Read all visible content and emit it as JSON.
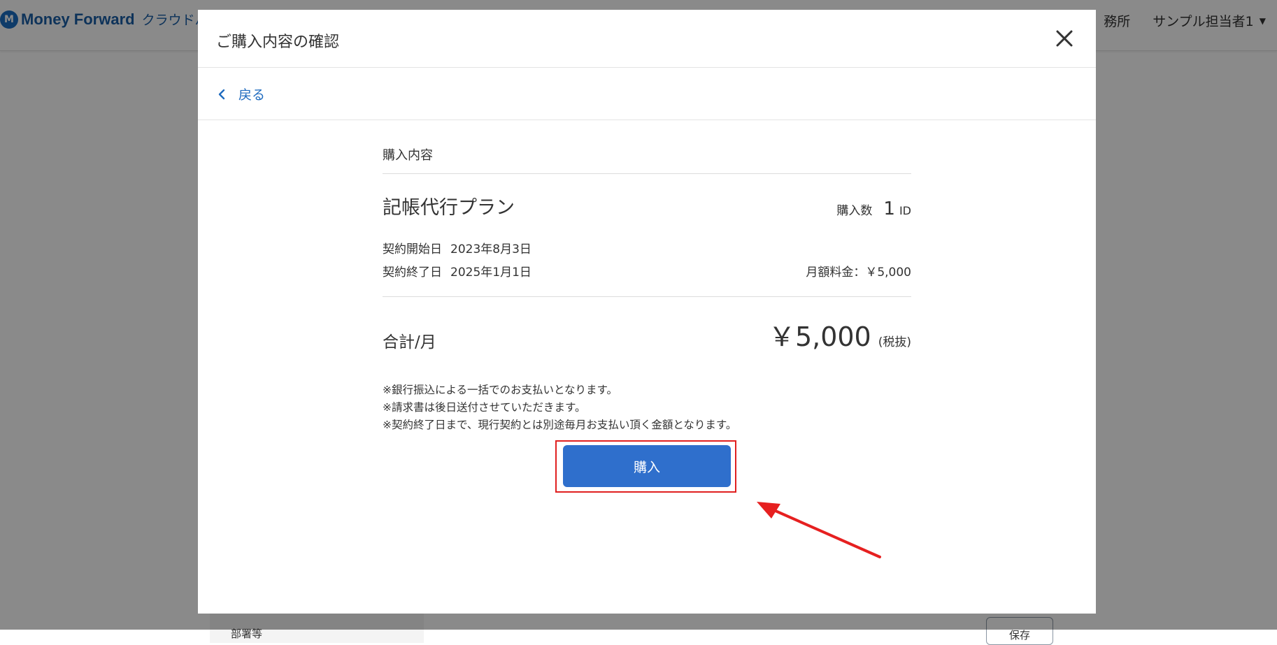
{
  "header": {
    "logo_mark": "M",
    "brand": "Money Forward",
    "product": "クラウドバ",
    "office": "務所",
    "user": "サンプル担当者1"
  },
  "background": {
    "left_item": "部署等",
    "right_button": "保存"
  },
  "modal": {
    "title": "ご購入内容の確認",
    "back_label": "戻る",
    "section_label": "購入内容",
    "plan_name": "記帳代行プラン",
    "quantity_label": "購入数",
    "quantity_value": "1",
    "quantity_unit": "ID",
    "start_label": "契約開始日",
    "start_value": "2023年8月3日",
    "end_label": "契約終了日",
    "end_value": "2025年1月1日",
    "monthly_fee": "月額料金：￥5,000",
    "total_label": "合計/月",
    "total_value": "￥5,000",
    "tax_note": "(税抜)",
    "notes": [
      "※銀行振込による一括でのお支払いとなります。",
      "※請求書は後日送付させていただきます。",
      "※契約終了日まで、現行契約とは別途毎月お支払い頂く金額となります。"
    ],
    "purchase_label": "購入"
  },
  "colors": {
    "primary": "#2f6fcc",
    "link": "#1f6bbf",
    "highlight": "#e02020"
  }
}
